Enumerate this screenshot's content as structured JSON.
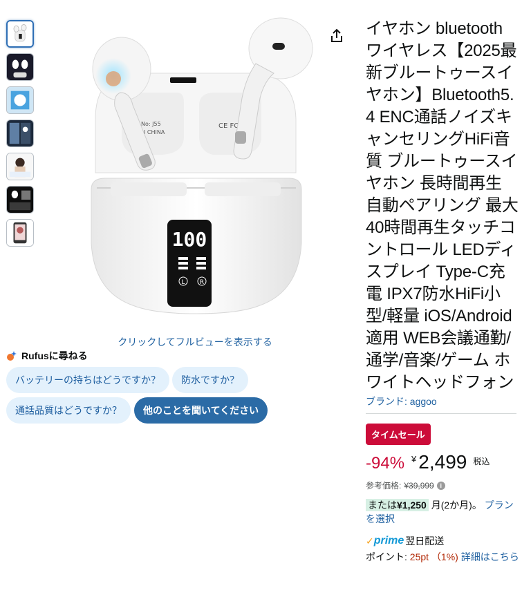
{
  "thumbnails": [
    {
      "name": "thumb-1",
      "active": true
    },
    {
      "name": "thumb-2",
      "active": false
    },
    {
      "name": "thumb-3",
      "active": false
    },
    {
      "name": "thumb-4",
      "active": false
    },
    {
      "name": "thumb-5",
      "active": false
    },
    {
      "name": "thumb-6",
      "active": false
    },
    {
      "name": "thumb-7",
      "active": false
    }
  ],
  "main_image": {
    "case_text_1": "No: J55",
    "case_text_2": "IN CHINA",
    "case_text_3": "CE FC",
    "display_digits": "100",
    "display_left": "L",
    "display_right": "R",
    "icon": "earbuds-product-image"
  },
  "share_icon": "share-icon",
  "fullview_link": "クリックしてフルビューを表示する",
  "rufus": {
    "label": "Rufusに尋ねる",
    "chips": [
      "バッテリーの持ちはどうですか？",
      "防水ですか？",
      "通話品質はどうですか？",
      "他のことを聞いてください"
    ]
  },
  "product": {
    "title": "イヤホン bluetooth ワイヤレス【2025最新ブルートゥースイヤホン】Bluetooth5.4 ENC通話ノイズキャンセリングHiFi音質 ブルートゥースイヤホン 長時間再生 自動ペアリング 最大40時間再生タッチコントロール LEDディスプレイ Type-C充電 IPX7防水HiFi小型/軽量 iOS/Android適用 WEB会議通勤/通学/音楽/ゲーム ホワイトヘッドフォン",
    "brand": "ブランド: aggoo",
    "deal_badge": "タイムセール",
    "discount": "-94%",
    "currency": "¥",
    "price": "2,499",
    "tax": "税込",
    "ref_label": "参考価格:",
    "ref_price": "¥39,999",
    "installment_prefix": "または",
    "installment_amount": "¥1,250",
    "installment_suffix": " 月(2か月)。 ",
    "installment_link": "プランを選択",
    "prime_check": "✓",
    "prime_word": "prime",
    "prime_delivery": "翌日配送",
    "points_label": "ポイント: ",
    "points_value": "25pt （1%)",
    "points_link": "詳細はこちら"
  },
  "colors": {
    "link": "#2162a1",
    "deal": "#cc0c39",
    "chip_bg": "#e3f1fc",
    "chip_dark": "#2b6ba6",
    "prime": "#1399d6"
  }
}
